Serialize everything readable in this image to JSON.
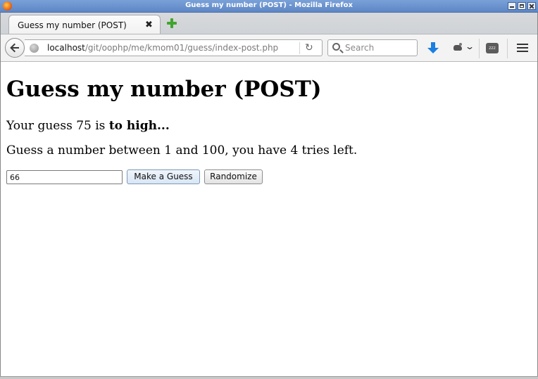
{
  "window": {
    "title": "Guess my number (POST) - Mozilla Firefox"
  },
  "tabs": [
    {
      "label": "Guess my number (POST)",
      "close": "✖"
    }
  ],
  "navbar": {
    "url_host": "localhost",
    "url_path": "/git/oophp/me/kmom01/guess/index-post.php",
    "reload_glyph": "↻",
    "search_placeholder": "Search",
    "sleep_label": "zzz"
  },
  "page": {
    "heading": "Guess my number (POST)",
    "result_prefix": "Your guess 75 is ",
    "result_emphasis": "to high...",
    "info": "Guess a number between 1 and 100, you have 4 tries left.",
    "guess_value": "66",
    "guess_button": "Make a Guess",
    "randomize_button": "Randomize"
  }
}
